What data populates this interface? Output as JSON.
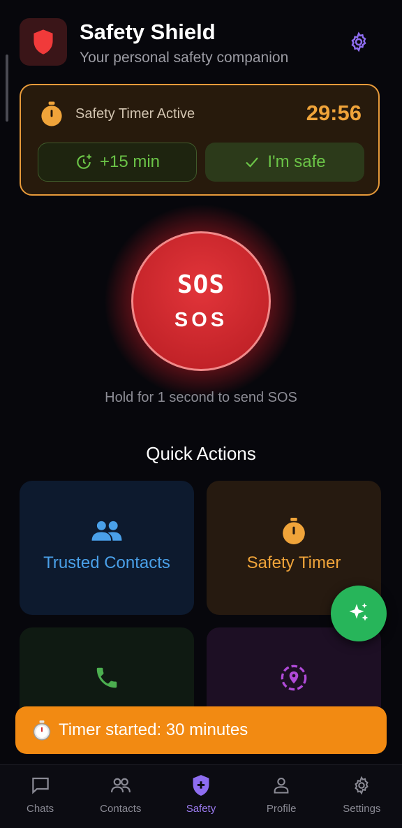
{
  "app": {
    "title": "Safety Shield",
    "subtitle": "Your personal safety companion",
    "logo_icon": "shield-icon",
    "settings_icon": "gear-icon"
  },
  "timer_card": {
    "label": "Safety Timer Active",
    "countdown": "29:56",
    "extend_label": "+15 min",
    "safe_label": "I'm safe",
    "icons": [
      "stopwatch-icon",
      "clock-plus-icon",
      "check-icon"
    ]
  },
  "sos": {
    "glyph_text": "SOS",
    "label": "SOS",
    "hint": "Hold for 1 second to send SOS"
  },
  "quick_actions": {
    "title": "Quick Actions",
    "cards": [
      {
        "label": "Trusted Contacts",
        "icon": "people-icon",
        "color": "#4aa0e8"
      },
      {
        "label": "Safety Timer",
        "icon": "stopwatch-icon",
        "color": "#f0a43a"
      },
      {
        "label": "",
        "icon": "phone-icon",
        "color": "#4caf50"
      },
      {
        "label": "",
        "icon": "location-icon",
        "color": "#b04ad8"
      }
    ]
  },
  "fab": {
    "icon": "sparkles-icon"
  },
  "snackbar": {
    "icon": "stopwatch-emoji-icon",
    "message": "Timer started: 30 minutes"
  },
  "nav": {
    "items": [
      {
        "label": "Chats",
        "icon": "chat-icon",
        "active": false
      },
      {
        "label": "Contacts",
        "icon": "contacts-icon",
        "active": false
      },
      {
        "label": "Safety",
        "icon": "shield-plus-icon",
        "active": true
      },
      {
        "label": "Profile",
        "icon": "person-icon",
        "active": false
      },
      {
        "label": "Settings",
        "icon": "gear-icon",
        "active": false
      }
    ]
  },
  "colors": {
    "background": "#07070c",
    "accent_orange": "#f0a43a",
    "sos_red": "#d32f2f",
    "success_green": "#6bc447",
    "active_purple": "#9d7cf2",
    "fab_green": "#27b55a",
    "snackbar_orange": "#f28a12"
  }
}
